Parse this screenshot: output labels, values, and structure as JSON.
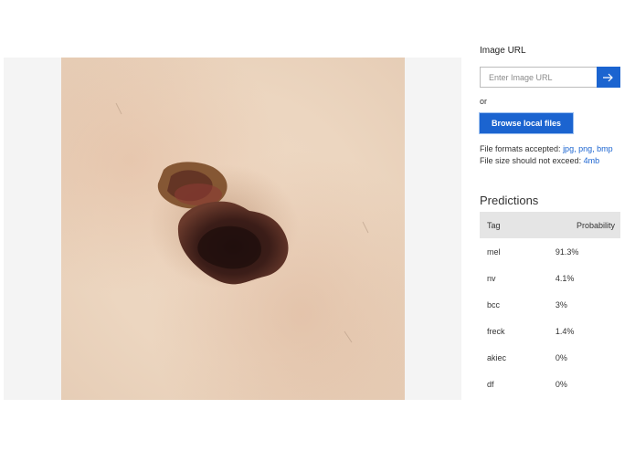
{
  "image_url": {
    "label": "Image URL",
    "placeholder": "Enter Image URL",
    "submit_icon": "arrow-right-icon"
  },
  "or_text": "or",
  "browse_button": "Browse local files",
  "formats": {
    "accepted_label": "File formats accepted:",
    "accepted_values": "jpg, png, bmp",
    "size_label": "File size should not exceed:",
    "size_value": "4mb"
  },
  "predictions": {
    "title": "Predictions",
    "columns": [
      "Tag",
      "Probability"
    ],
    "rows": [
      {
        "tag": "mel",
        "probability": "91.3%"
      },
      {
        "tag": "nv",
        "probability": "4.1%"
      },
      {
        "tag": "bcc",
        "probability": "3%"
      },
      {
        "tag": "freck",
        "probability": "1.4%"
      },
      {
        "tag": "akiec",
        "probability": "0%"
      },
      {
        "tag": "df",
        "probability": "0%"
      }
    ]
  },
  "colors": {
    "accent": "#1b64d0",
    "table_header_bg": "#e5e5e5"
  }
}
